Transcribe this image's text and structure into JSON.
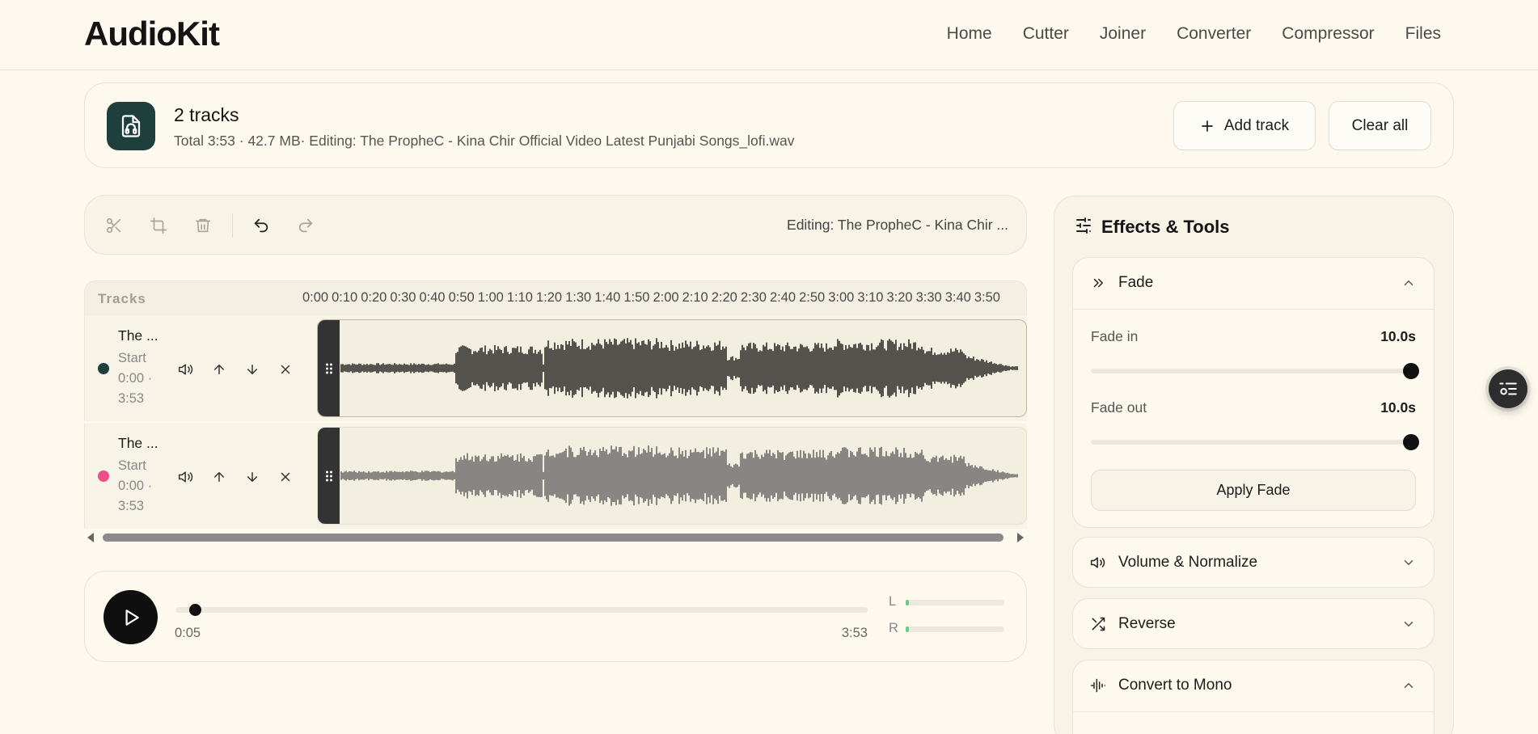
{
  "app": {
    "title": "AudioKit"
  },
  "nav": [
    "Home",
    "Cutter",
    "Joiner",
    "Converter",
    "Compressor",
    "Files"
  ],
  "summary": {
    "title": "2 tracks",
    "subtitle": "Total 3:53 · 42.7 MB· Editing: The PropheC - Kina Chir Official Video Latest Punjabi Songs_lofi.wav",
    "add_label": "Add track",
    "clear_label": "Clear all"
  },
  "toolbar": {
    "editing": "Editing: The PropheC - Kina Chir ..."
  },
  "timeline": {
    "header_label": "Tracks",
    "ticks": [
      "0:00",
      "0:10",
      "0:20",
      "0:30",
      "0:40",
      "0:50",
      "1:00",
      "1:10",
      "1:20",
      "1:30",
      "1:40",
      "1:50",
      "2:00",
      "2:10",
      "2:20",
      "2:30",
      "2:40",
      "2:50",
      "3:00",
      "3:10",
      "3:20",
      "3:30",
      "3:40",
      "3:50"
    ]
  },
  "tracks": [
    {
      "name": "The ...",
      "meta": "Start 0:00 · 3:53",
      "color": "#1f3f3d",
      "wave_color": "#111111"
    },
    {
      "name": "The ...",
      "meta": "Start 0:00 · 3:53",
      "color": "#ee4f86",
      "wave_color": "#5a5a5a"
    }
  ],
  "player": {
    "current_time": "0:05",
    "total_time": "3:53",
    "progress": 0.021,
    "vu_left_label": "L",
    "vu_right_label": "R",
    "vu_left_level": 0.03,
    "vu_right_level": 0.03
  },
  "effects": {
    "title": "Effects & Tools",
    "fade": {
      "label": "Fade",
      "fade_in_label": "Fade in",
      "fade_in_value": "10.0s",
      "fade_in_level": 1.0,
      "fade_out_label": "Fade out",
      "fade_out_value": "10.0s",
      "fade_out_level": 1.0,
      "apply_label": "Apply Fade"
    },
    "volume": {
      "label": "Volume & Normalize"
    },
    "reverse": {
      "label": "Reverse"
    },
    "mono": {
      "label": "Convert to Mono"
    }
  },
  "colors": {
    "accent": "#1f3f3d",
    "background": "#fdf9ee"
  }
}
